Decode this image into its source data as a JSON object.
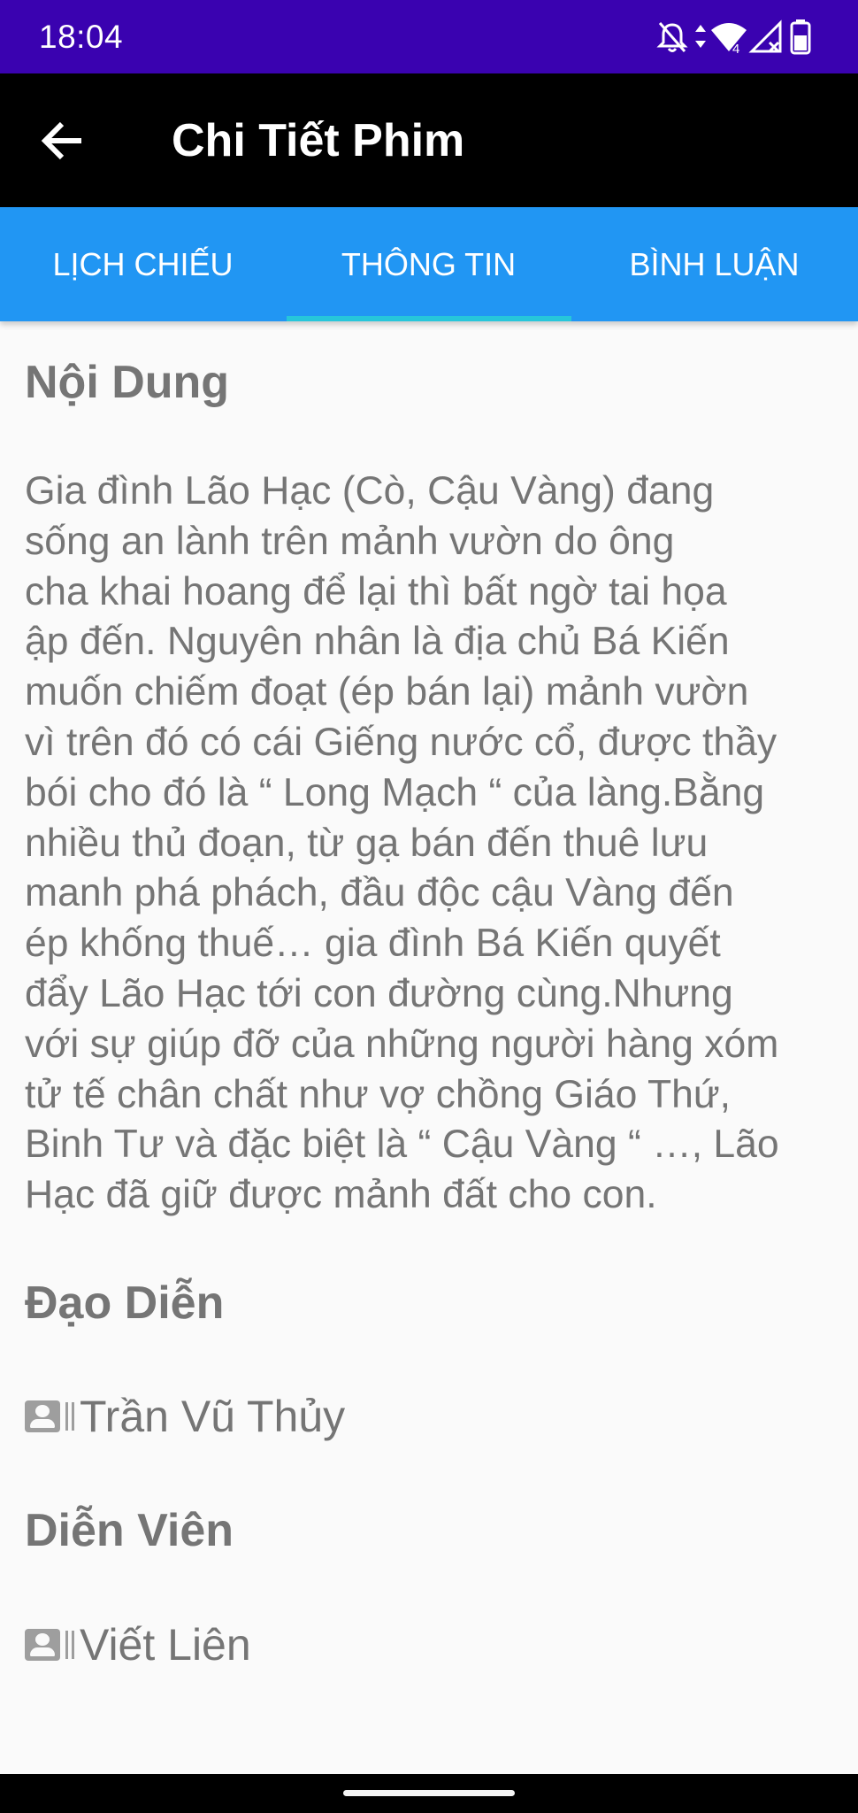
{
  "status_bar": {
    "time": "18:04",
    "icons": [
      "notifications-off-icon",
      "data-arrows-icon",
      "wifi-icon",
      "signal-icon",
      "battery-icon"
    ],
    "wifi_badge": "4",
    "background_color": "#3a02b0"
  },
  "app_bar": {
    "back_icon": "arrow-left-icon",
    "title": "Chi Tiết Phim",
    "background_color": "#000000"
  },
  "tabs": {
    "items": [
      {
        "label": "LỊCH CHIẾU",
        "selected": false
      },
      {
        "label": "THÔNG TIN",
        "selected": true
      },
      {
        "label": "BÌNH LUẬN",
        "selected": false
      }
    ],
    "background_color": "#2196f3",
    "indicator_color": "#26c6da"
  },
  "content": {
    "synopsis_heading": "Nội Dung",
    "synopsis_lines": [
      "Gia đình Lão Hạc (Cò, Cậu Vàng) đang",
      "sống an lành trên mảnh vườn do ông",
      "cha khai hoang để lại thì bất ngờ tai họa",
      "ập đến. Nguyên nhân là địa chủ Bá Kiến",
      "muốn chiếm đoạt (ép bán lại) mảnh vườn",
      "vì trên đó có cái Giếng nước cổ, được thầy",
      "bói cho đó là “ Long Mạch “ của làng.Bằng",
      "nhiều thủ đoạn, từ gạ bán đến thuê lưu",
      "manh phá phách, đầu độc cậu Vàng đến",
      "ép khống thuế… gia đình Bá Kiến quyết",
      "đẩy Lão Hạc tới con đường cùng.Nhưng",
      "với sự giúp đỡ của những người hàng xóm",
      "tử tế chân chất như vợ chồng Giáo Thứ,",
      "Binh Tư và đặc biệt là “ Cậu Vàng “ …, Lão",
      "Hạc đã giữ được mảnh đất cho con."
    ],
    "director_heading": "Đạo Diễn",
    "director_name": "Trần Vũ Thủy",
    "cast_heading": "Diễn Viên",
    "cast_name": "Viết Liên",
    "person_icon": "contact-card-icon",
    "text_color": "#757575"
  },
  "nav_bar": {
    "handle_icon": "gesture-handle"
  }
}
